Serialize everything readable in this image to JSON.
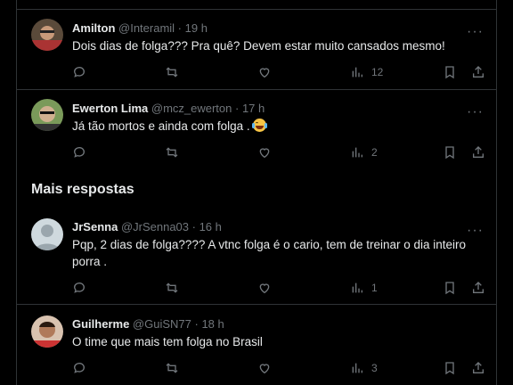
{
  "tweets": [
    {
      "name": "Amilton",
      "handle": "@Interamil",
      "time": "19 h",
      "text": "Dois dias de folga??? Pra quê? Devem estar muito cansados mesmo!",
      "views": "12"
    },
    {
      "name": "Ewerton Lima",
      "handle": "@mcz_ewerton",
      "time": "17 h",
      "text": "Já tão mortos e ainda com folga .",
      "emoji": "face-with-tears-of-joy",
      "views": "2"
    },
    {
      "name": "JrSenna",
      "handle": "@JrSenna03",
      "time": "16 h",
      "text": "Pqp, 2 dias de folga???? A vtnc folga é o cario, tem de treinar o dia inteiro porra .",
      "views": "1"
    },
    {
      "name": "Guilherme",
      "handle": "@GuiSN77",
      "time": "18 h",
      "text": "O time que mais tem folga no Brasil",
      "views": "3"
    }
  ],
  "section_title": "Mais respostas",
  "separator": " · ",
  "more_label": "···",
  "colors": {
    "background": "#000000",
    "text": "#e7e9ea",
    "muted": "#71767b",
    "border": "#2f3336"
  }
}
